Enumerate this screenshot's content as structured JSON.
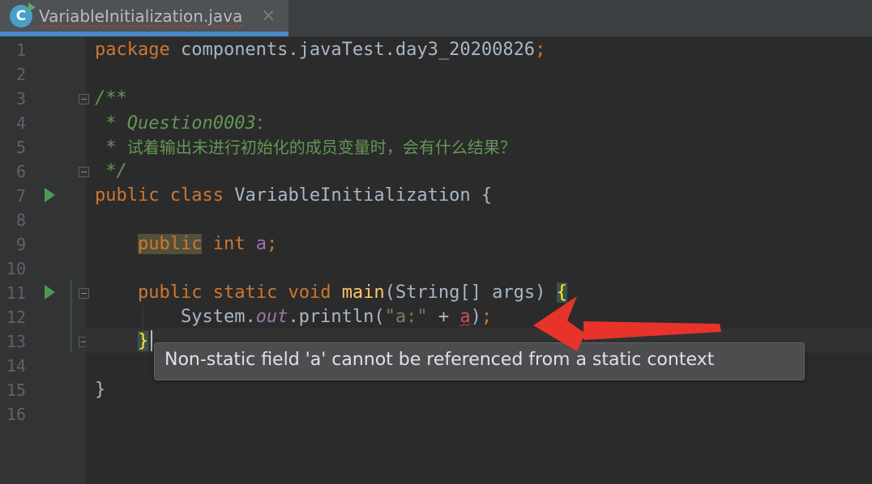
{
  "tab": {
    "filename": "VariableInitialization.java",
    "file_icon_letter": "C",
    "close_glyph": "×"
  },
  "line_numbers": [
    "1",
    "2",
    "3",
    "4",
    "5",
    "6",
    "7",
    "8",
    "9",
    "10",
    "11",
    "12",
    "13",
    "14",
    "15",
    "16"
  ],
  "code": {
    "line1": {
      "kw": "package",
      "rest": " components.javaTest.day3_20200826",
      "semi": ";"
    },
    "line3": "/**",
    "line4": {
      "star": " * ",
      "tag": "Question0003",
      "colon": "："
    },
    "line5": {
      "star": " * ",
      "text": "试着输出未进行初始化的成员变量时，会有什么结果？"
    },
    "line6": " */",
    "line7": {
      "kw1": "public",
      "kw2": "class",
      "name": " VariableInitialization {"
    },
    "line9": {
      "indent": "    ",
      "kw1": "public",
      "kw2": "int",
      "field": "a",
      "semi": ";"
    },
    "line11": {
      "indent": "    ",
      "kw1": "public",
      "kw2": "static",
      "kw3": "void",
      "method": "main",
      "params": "(String[] args) ",
      "brace": "{"
    },
    "line12": {
      "indent": "        ",
      "cls": "System.",
      "out": "out",
      "call": ".println(",
      "str": "\"a:\"",
      "plus": " + ",
      "var": "a",
      "end": ")",
      "semi": ";"
    },
    "line13": {
      "indent": "    ",
      "brace": "}"
    },
    "line15": "}"
  },
  "tooltip": {
    "message": "Non-static field 'a' cannot be referenced from a static context"
  },
  "colors": {
    "background": "#2b2b2b",
    "keyword": "#cc7832",
    "field": "#9876aa",
    "string": "#6a8759",
    "doc_comment": "#629755",
    "error_arrow": "#e8332a"
  }
}
